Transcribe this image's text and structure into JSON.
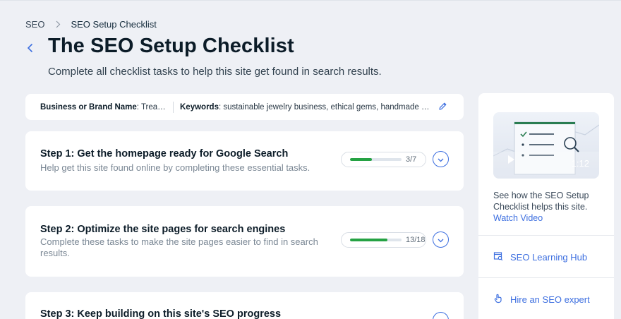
{
  "breadcrumb": {
    "root": "SEO",
    "current": "SEO Setup Checklist"
  },
  "header": {
    "title": "The SEO Setup Checklist",
    "subtitle": "Complete all checklist tasks to help this site get found in search results."
  },
  "info_bar": {
    "brand_label": "Business or Brand Name",
    "brand_value": ": Treasur…",
    "keywords_label": "Keywords",
    "keywords_value": ": sustainable jewelry business, ethical gems, handmade jew…"
  },
  "steps": [
    {
      "title": "Step 1: Get the homepage ready for Google Search",
      "description": "Help get this site found online by completing these essential tasks.",
      "progress_text": "3/7",
      "completed": 3,
      "total": 7
    },
    {
      "title": "Step 2: Optimize the site pages for search engines",
      "description": "Complete these tasks to make the site pages easier to find in search results.",
      "progress_text": "13/18",
      "completed": 13,
      "total": 18
    },
    {
      "title": "Step 3: Keep building on this site's SEO progress"
    }
  ],
  "side_panel": {
    "video_duration": "1:12",
    "video_caption": "See how the SEO Setup Checklist helps this site.",
    "watch_video": "Watch Video",
    "learning_hub": "SEO Learning Hub",
    "hire_expert": "Hire an SEO expert"
  },
  "colors": {
    "accent": "#3d6fe0",
    "progress": "#25a244",
    "background": "#eef0f5"
  },
  "icons": [
    "chevron-right-icon",
    "chevron-left-icon",
    "pencil-icon",
    "chevron-down-icon",
    "play-icon",
    "learning-hub-icon",
    "expert-hand-icon"
  ]
}
